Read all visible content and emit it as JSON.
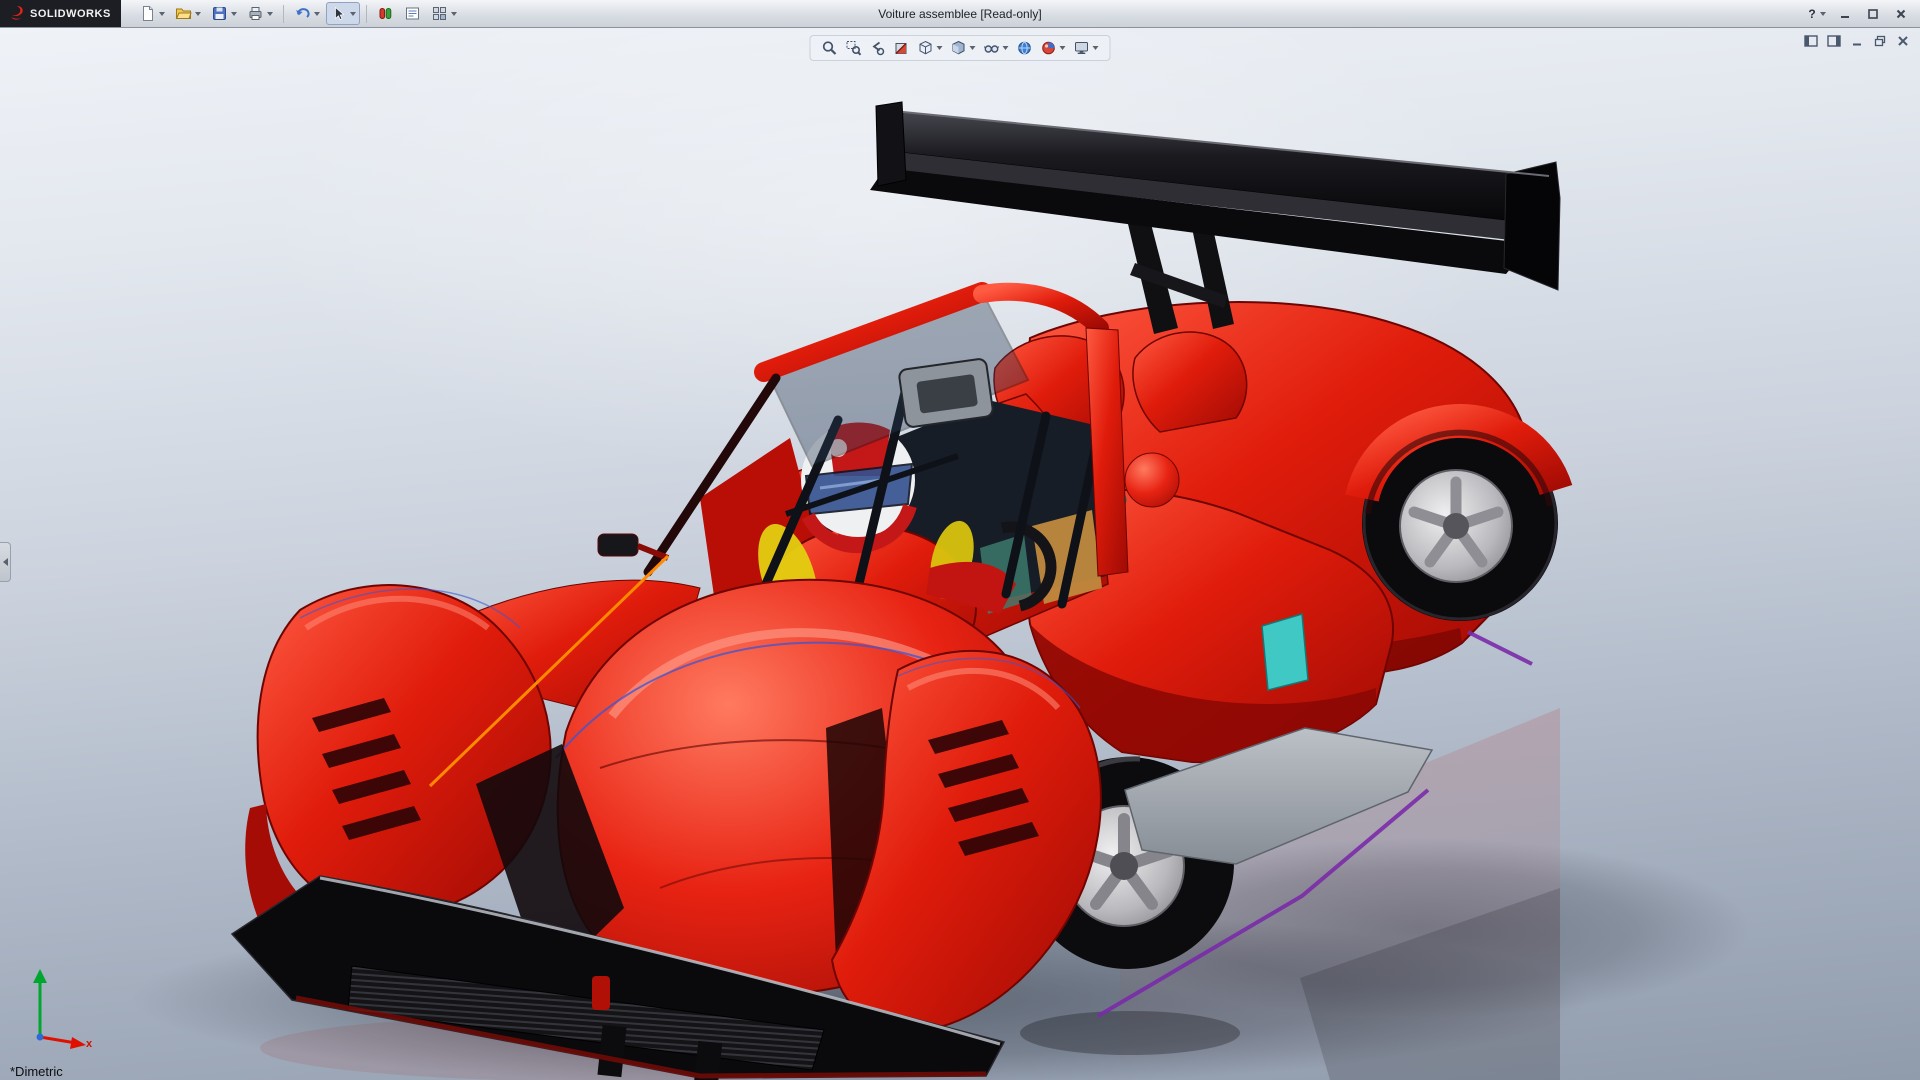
{
  "titlebar": {
    "brand": "SOLIDWORKS",
    "title": "Voiture assemblee [Read-only]",
    "help_label": "?",
    "toolbar_icons": [
      "new-document-icon",
      "open-icon",
      "save-icon",
      "print-icon",
      "undo-icon",
      "select-cursor-icon",
      "edit-color-icon",
      "drawing-sheet-icon",
      "options-grid-icon"
    ],
    "window_control_icons": [
      "help-icon",
      "minimize-icon",
      "maximize-icon",
      "close-icon"
    ]
  },
  "headsup_toolbar": {
    "icons": [
      "zoom-to-fit-icon",
      "zoom-to-area-icon",
      "previous-view-icon",
      "section-view-icon",
      "view-orientation-icon",
      "display-style-icon",
      "hide-show-items-icon",
      "apply-scene-icon",
      "edit-appearance-icon",
      "view-settings-icon"
    ]
  },
  "document_window": {
    "control_icons": [
      "panel-left-icon",
      "panel-right-icon",
      "minimize-icon",
      "restore-icon",
      "close-icon"
    ]
  },
  "viewport": {
    "status_label": "*Dimetric",
    "triad_x_label": "x",
    "model_description": "red open-cockpit race car assembly with rear wing and helmeted driver"
  },
  "model_colors": {
    "body_red": "#d81408",
    "wing_black": "#101013",
    "helmet_white": "#eef0f2",
    "visor_blue": "#33518f",
    "accent_yellow": "#e2cf10",
    "window_teal": "#3fc8c4",
    "trim_purple": "#7a2ba8",
    "rim_silver": "#c9c9cd"
  }
}
